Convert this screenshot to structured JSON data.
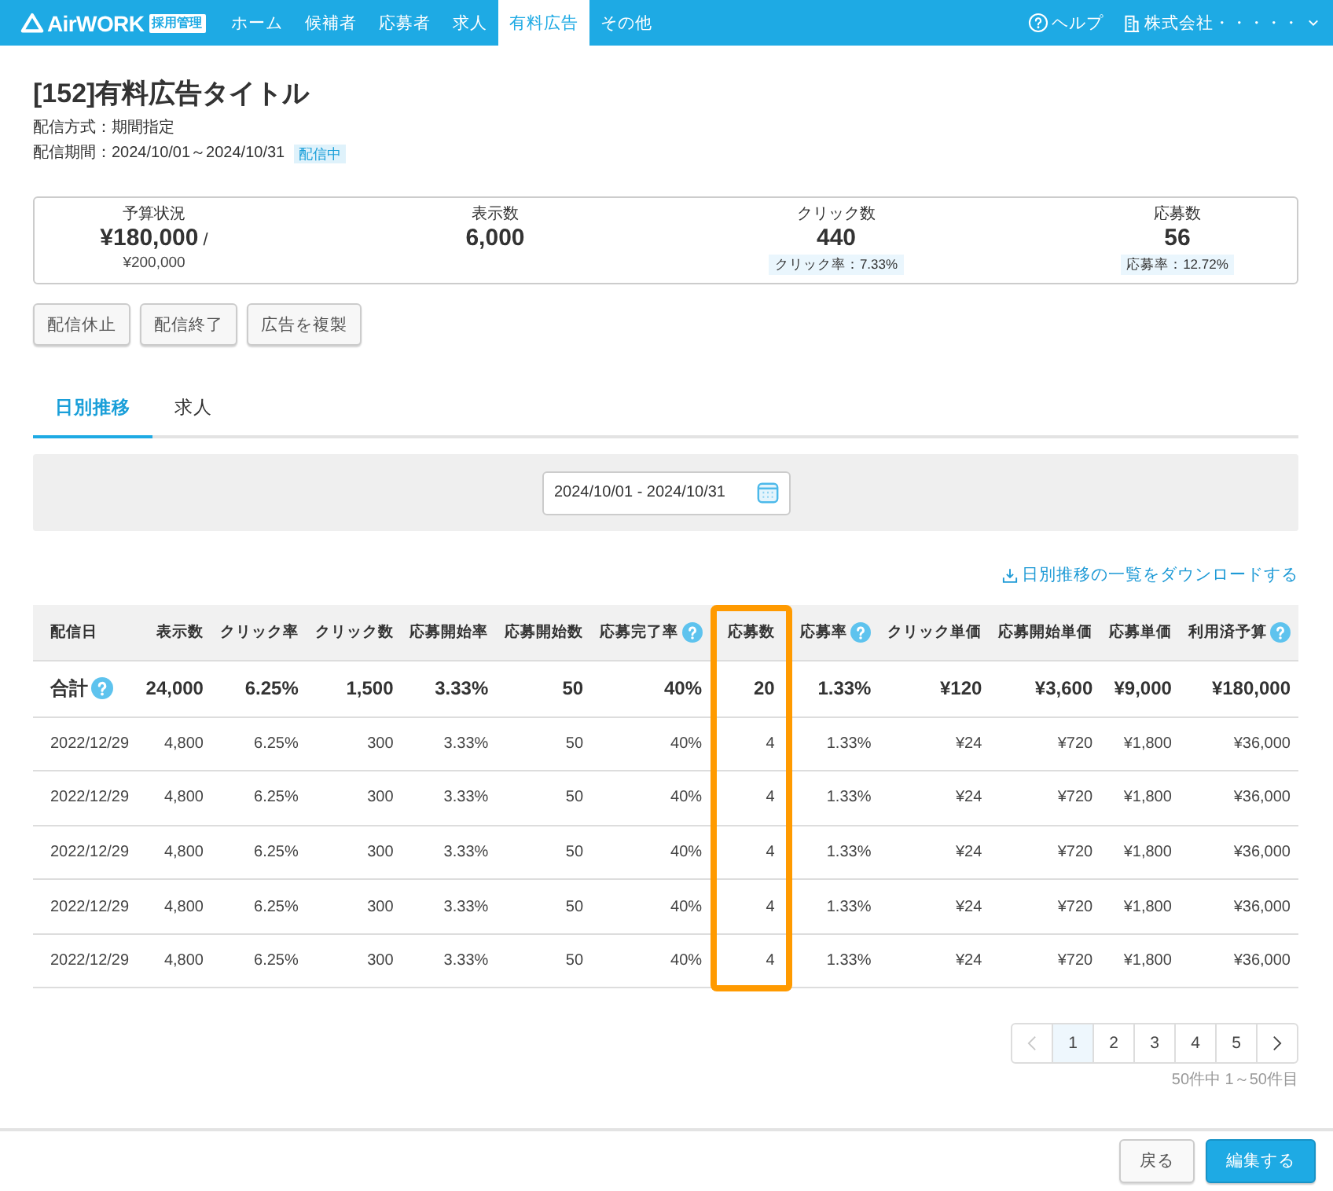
{
  "header": {
    "logo": {
      "name": "AirWORK",
      "badge": "採用管理"
    },
    "nav": [
      {
        "label": "ホーム",
        "selected": false
      },
      {
        "label": "候補者",
        "selected": false
      },
      {
        "label": "応募者",
        "selected": false
      },
      {
        "label": "求人",
        "selected": false
      },
      {
        "label": "有料広告",
        "selected": true
      },
      {
        "label": "その他",
        "selected": false
      }
    ],
    "help": "ヘルプ",
    "company": "株式会社・・・・・"
  },
  "title": "[152]有料広告タイトル",
  "meta": [
    {
      "text": "配信方式：期間指定"
    },
    {
      "text": "配信期間：2024/10/01～2024/10/31",
      "badge": "配信中"
    }
  ],
  "stats": [
    {
      "label": "予算状況",
      "value": "¥180,000",
      "suffix": "/",
      "sub": "¥200,000"
    },
    {
      "label": "表示数",
      "value": "6,000"
    },
    {
      "label": "クリック数",
      "value": "440",
      "note": "クリック率：7.33%"
    },
    {
      "label": "応募数",
      "value": "56",
      "note": "応募率：12.72%"
    }
  ],
  "actions": [
    "配信休止",
    "配信終了",
    "広告を複製"
  ],
  "tabs": [
    {
      "label": "日別推移",
      "selected": true
    },
    {
      "label": "求人",
      "selected": false
    }
  ],
  "filter": {
    "date_range": "2024/10/01 - 2024/10/31"
  },
  "download_link": "日別推移の一覧をダウンロードする",
  "table": {
    "columns": [
      {
        "label": "配信日",
        "help": false,
        "highlighted": false
      },
      {
        "label": "表示数",
        "help": false,
        "highlighted": false
      },
      {
        "label": "クリック率",
        "help": false,
        "highlighted": false
      },
      {
        "label": "クリック数",
        "help": false,
        "highlighted": false
      },
      {
        "label": "応募開始率",
        "help": false,
        "highlighted": false
      },
      {
        "label": "応募開始数",
        "help": false,
        "highlighted": false
      },
      {
        "label": "応募完了率",
        "help": true,
        "highlighted": false
      },
      {
        "label": "応募数",
        "help": false,
        "highlighted": true
      },
      {
        "label": "応募率",
        "help": true,
        "highlighted": false
      },
      {
        "label": "クリック単価",
        "help": false,
        "highlighted": false
      },
      {
        "label": "応募開始単価",
        "help": false,
        "highlighted": false
      },
      {
        "label": "応募単価",
        "help": false,
        "highlighted": false
      },
      {
        "label": "利用済予算",
        "help": true,
        "highlighted": false
      }
    ],
    "total": {
      "label": "合計",
      "help": true,
      "cells": [
        "24,000",
        "6.25%",
        "1,500",
        "3.33%",
        "50",
        "40%",
        "20",
        "1.33%",
        "¥120",
        "¥3,600",
        "¥9,000",
        "¥180,000"
      ]
    },
    "rows": [
      {
        "cells": [
          "2022/12/29",
          "4,800",
          "6.25%",
          "300",
          "3.33%",
          "50",
          "40%",
          "4",
          "1.33%",
          "¥24",
          "¥720",
          "¥1,800",
          "¥36,000"
        ]
      },
      {
        "cells": [
          "2022/12/29",
          "4,800",
          "6.25%",
          "300",
          "3.33%",
          "50",
          "40%",
          "4",
          "1.33%",
          "¥24",
          "¥720",
          "¥1,800",
          "¥36,000"
        ]
      },
      {
        "cells": [
          "2022/12/29",
          "4,800",
          "6.25%",
          "300",
          "3.33%",
          "50",
          "40%",
          "4",
          "1.33%",
          "¥24",
          "¥720",
          "¥1,800",
          "¥36,000"
        ]
      },
      {
        "cells": [
          "2022/12/29",
          "4,800",
          "6.25%",
          "300",
          "3.33%",
          "50",
          "40%",
          "4",
          "1.33%",
          "¥24",
          "¥720",
          "¥1,800",
          "¥36,000"
        ]
      },
      {
        "cells": [
          "2022/12/29",
          "4,800",
          "6.25%",
          "300",
          "3.33%",
          "50",
          "40%",
          "4",
          "1.33%",
          "¥24",
          "¥720",
          "¥1,800",
          "¥36,000"
        ]
      }
    ]
  },
  "pagination": {
    "prev": {
      "disabled": true
    },
    "next": {
      "disabled": false
    },
    "pages": [
      {
        "label": "1",
        "selected": true
      },
      {
        "label": "2",
        "selected": false
      },
      {
        "label": "3",
        "selected": false
      },
      {
        "label": "4",
        "selected": false
      },
      {
        "label": "5",
        "selected": false
      }
    ],
    "summary": "50件中 1～50件目"
  },
  "footer_buttons": [
    {
      "label": "戻る",
      "kind": "secondary"
    },
    {
      "label": "編集する",
      "kind": "primary"
    }
  ]
}
